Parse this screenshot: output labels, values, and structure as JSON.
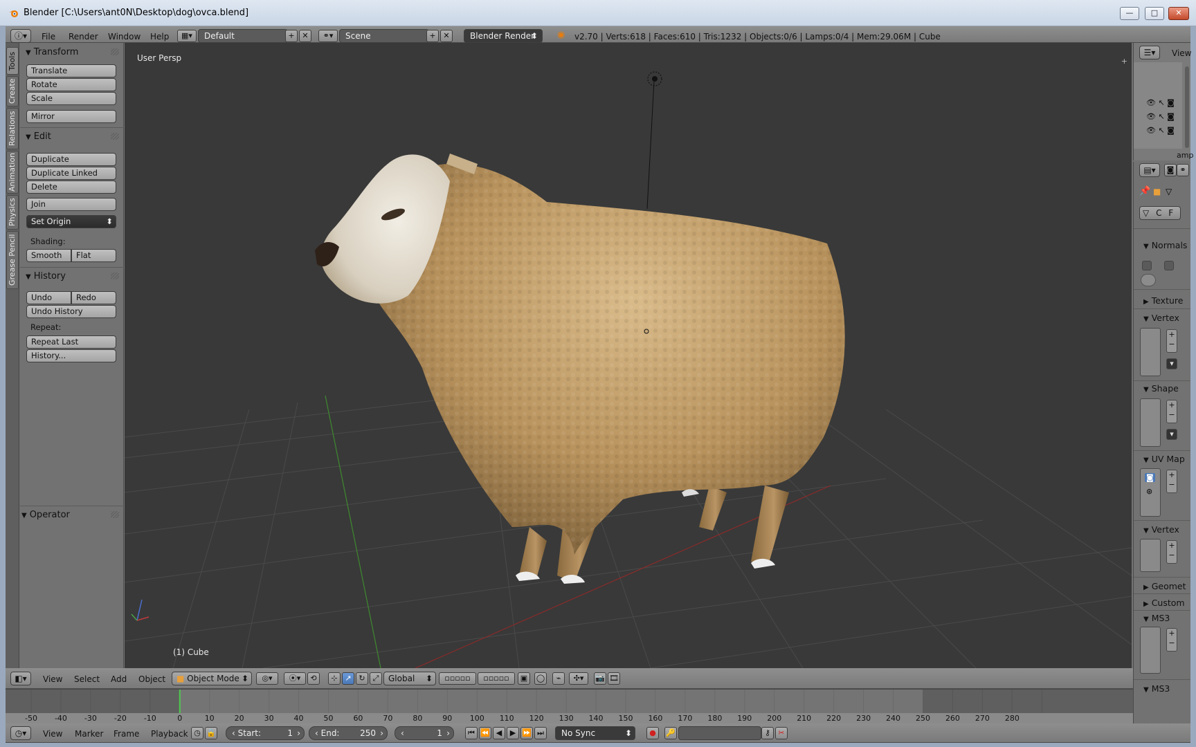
{
  "window": {
    "title": "Blender [C:\\Users\\ant0N\\Desktop\\dog\\ovca.blend]",
    "min": "—",
    "max": "□",
    "close": "✕"
  },
  "topbar": {
    "menu": [
      "File",
      "Render",
      "Window",
      "Help"
    ],
    "layout": "Default",
    "scene": "Scene",
    "engine": "Blender Render",
    "stats": "v2.70 | Verts:618 | Faces:610 | Tris:1232 | Objects:0/6 | Lamps:0/4 | Mem:29.06M | Cube"
  },
  "vertical_tabs": [
    "Tools",
    "Create",
    "Relations",
    "Animation",
    "Physics",
    "Grease Pencil"
  ],
  "toolshelf": {
    "transform": {
      "title": "Transform",
      "buttons": [
        "Translate",
        "Rotate",
        "Scale",
        "Mirror"
      ]
    },
    "edit": {
      "title": "Edit",
      "buttons": [
        "Duplicate",
        "Duplicate Linked",
        "Delete",
        "Join"
      ],
      "set_origin": "Set Origin",
      "shading_label": "Shading:",
      "smooth": "Smooth",
      "flat": "Flat"
    },
    "history": {
      "title": "History",
      "undo": "Undo",
      "redo": "Redo",
      "undo_history": "Undo History",
      "repeat_label": "Repeat:",
      "repeat_last": "Repeat Last",
      "history": "History..."
    },
    "operator": {
      "title": "Operator"
    }
  },
  "viewport": {
    "view_label": "User Persp",
    "object_label": "(1) Cube",
    "background": "#393939",
    "grid_color": "#4a4a4a",
    "x_axis_color": "#8b2a2a",
    "y_axis_color": "#3f8a2f"
  },
  "viewport_header": {
    "menu": [
      "View",
      "Select",
      "Add",
      "Object"
    ],
    "mode": "Object Mode",
    "orientation": "Global"
  },
  "outliner": {
    "view": "View",
    "partial_item": "amp"
  },
  "properties": {
    "tabs_row": [
      "C",
      "F"
    ],
    "panels": [
      {
        "title": "Normals",
        "open": true
      },
      {
        "title": "Texture",
        "open": false
      },
      {
        "title": "Vertex",
        "open": true
      },
      {
        "title": "Shape",
        "open": true
      },
      {
        "title": "UV Map",
        "open": true
      },
      {
        "title": "Vertex",
        "open": true
      },
      {
        "title": "Geomet",
        "open": false
      },
      {
        "title": "Custom",
        "open": false
      },
      {
        "title": "MS3",
        "open": true
      },
      {
        "title": "MS3",
        "open": true
      }
    ]
  },
  "timeline": {
    "ticks": [
      "-50",
      "-40",
      "-30",
      "-20",
      "-10",
      "0",
      "10",
      "20",
      "30",
      "40",
      "50",
      "60",
      "70",
      "80",
      "90",
      "100",
      "110",
      "120",
      "130",
      "140",
      "150",
      "160",
      "170",
      "180",
      "190",
      "200",
      "210",
      "220",
      "230",
      "240",
      "250",
      "260",
      "270",
      "280"
    ],
    "current_frame_value": 0,
    "end_value": 250
  },
  "statusbar": {
    "menu": [
      "View",
      "Marker",
      "Frame",
      "Playback"
    ],
    "start": "Start:",
    "start_value": "1",
    "end": "End:",
    "end_value": "250",
    "current": "1",
    "sync": "No Sync"
  }
}
